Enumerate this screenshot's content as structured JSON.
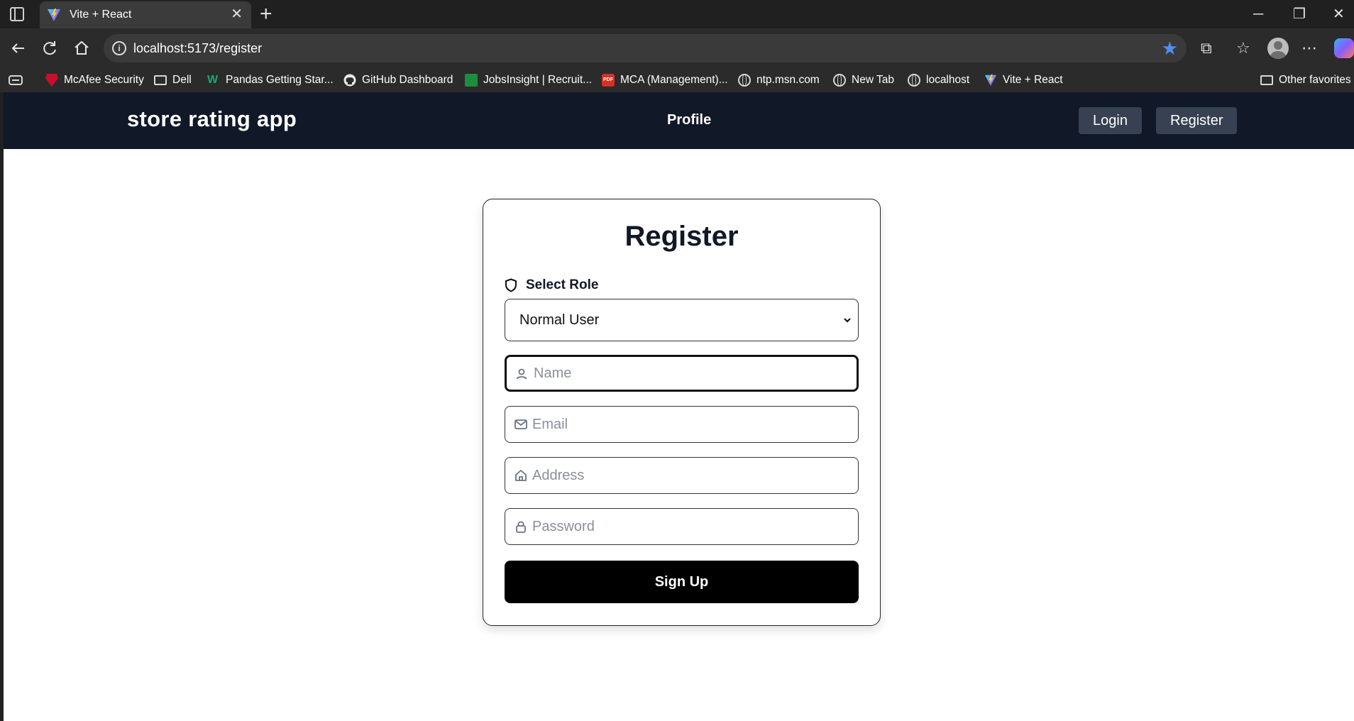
{
  "browser": {
    "tab_title": "Vite + React",
    "url": "localhost:5173/register",
    "bookmarks": [
      {
        "label": "McAfee Security",
        "icon": "mcafee-icon"
      },
      {
        "label": "Dell",
        "icon": "folder-icon"
      },
      {
        "label": "Pandas Getting Star...",
        "icon": "pandas-icon"
      },
      {
        "label": "GitHub Dashboard",
        "icon": "github-icon"
      },
      {
        "label": "JobsInsight | Recruit...",
        "icon": "jobsinsight-icon"
      },
      {
        "label": "MCA (Management)...",
        "icon": "pdf-icon"
      },
      {
        "label": "ntp.msn.com",
        "icon": "globe-icon"
      },
      {
        "label": "New Tab",
        "icon": "globe-icon"
      },
      {
        "label": "localhost",
        "icon": "globe-icon"
      },
      {
        "label": "Vite + React",
        "icon": "vite-icon"
      }
    ],
    "other_favorites": "Other favorites"
  },
  "app": {
    "brand": "store rating app",
    "nav": {
      "profile": "Profile",
      "login": "Login",
      "register": "Register"
    },
    "colors": {
      "navbar": "#111827",
      "nav_button": "#374151",
      "primary_button": "#000000"
    }
  },
  "form": {
    "title": "Register",
    "role_label": "Select Role",
    "role_value": "Normal User",
    "name_placeholder": "Name",
    "email_placeholder": "Email",
    "address_placeholder": "Address",
    "password_placeholder": "Password",
    "submit_label": "Sign Up"
  }
}
